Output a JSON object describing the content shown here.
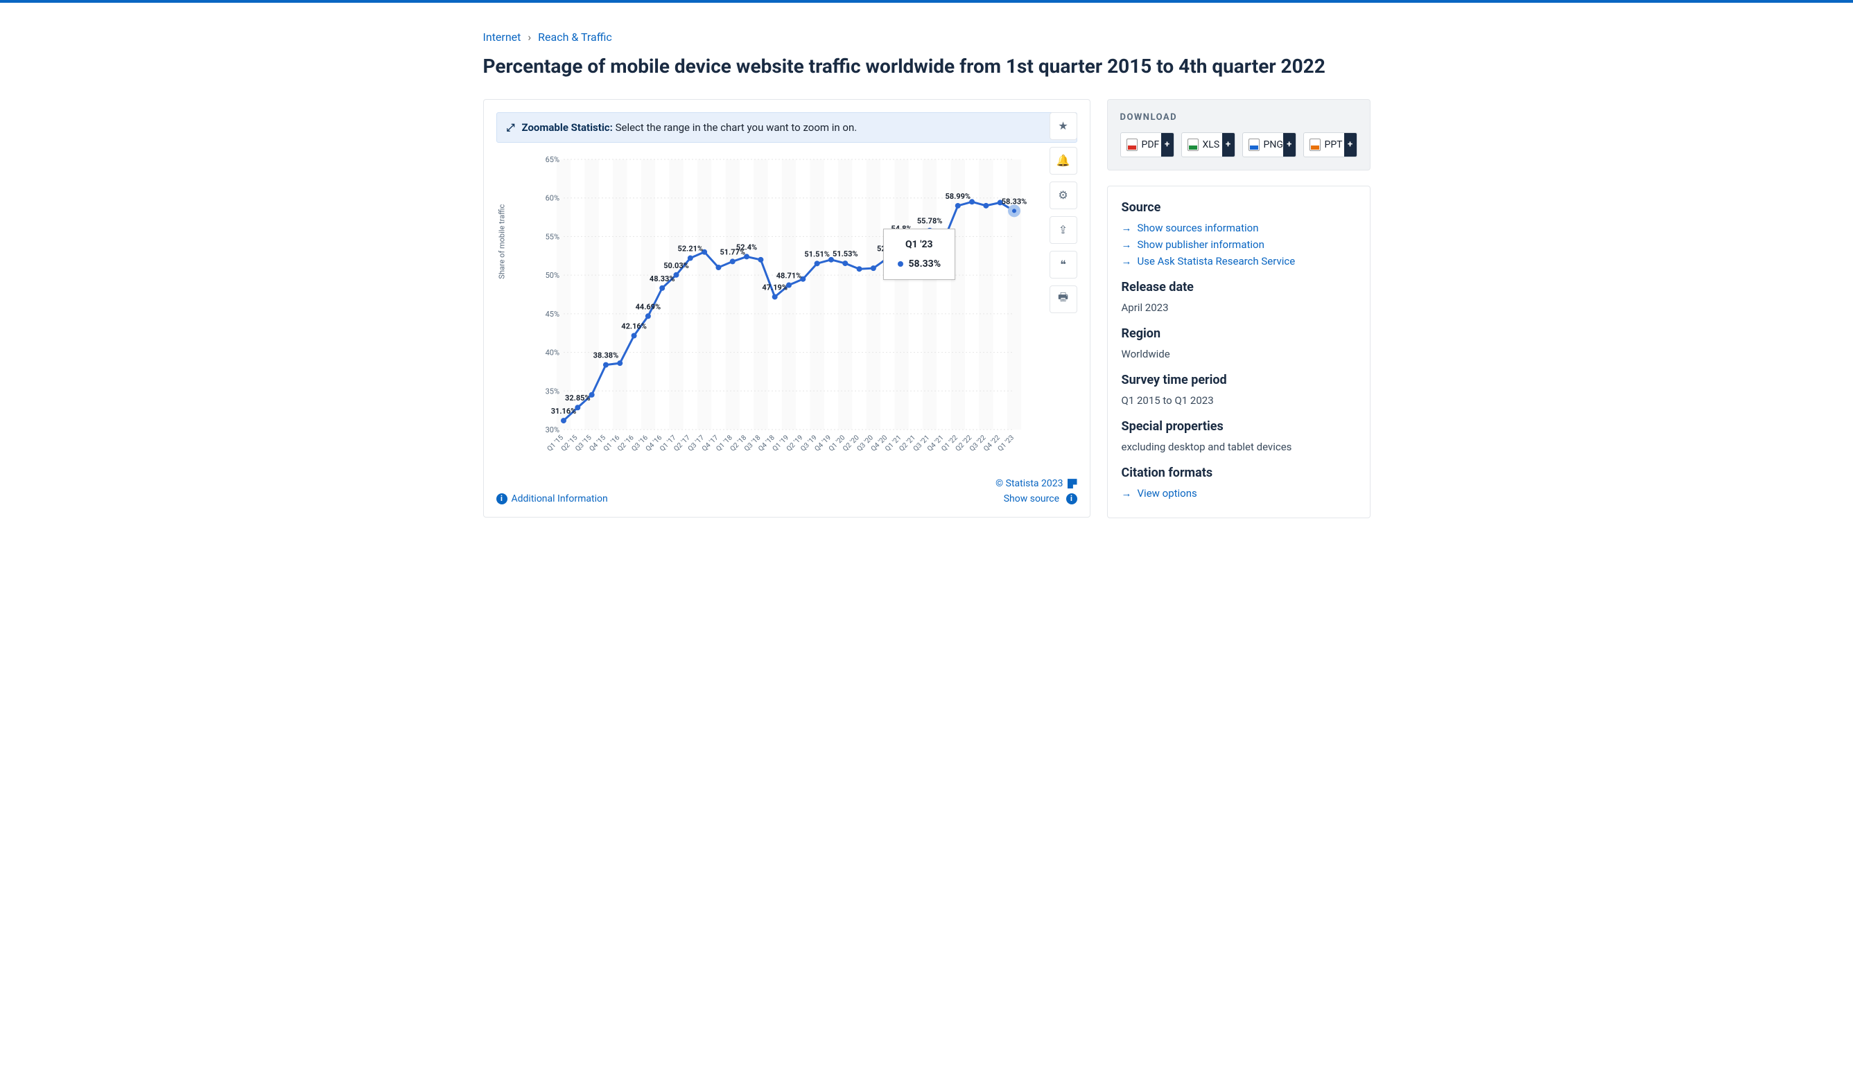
{
  "breadcrumbs": [
    "Internet",
    "Reach & Traffic"
  ],
  "title": "Percentage of mobile device website traffic worldwide from 1st quarter 2015 to 4th quarter 2022",
  "zoom_hint": {
    "label": "Zoomable Statistic:",
    "text": "Select the range in the chart you want to zoom in on."
  },
  "tooltip": {
    "quarter": "Q1 '23",
    "value": "58.33%"
  },
  "footer": {
    "additional": "Additional Information",
    "copyright": "© Statista 2023",
    "show_source": "Show source"
  },
  "download": {
    "heading": "DOWNLOAD",
    "buttons": [
      "PDF",
      "XLS",
      "PNG",
      "PPT"
    ]
  },
  "source": {
    "heading": "Source",
    "links": [
      "Show sources information",
      "Show publisher information",
      "Use Ask Statista Research Service"
    ]
  },
  "meta": [
    {
      "h": "Release date",
      "v": "April 2023"
    },
    {
      "h": "Region",
      "v": "Worldwide"
    },
    {
      "h": "Survey time period",
      "v": "Q1 2015 to Q1 2023"
    },
    {
      "h": "Special properties",
      "v": "excluding desktop and tablet devices"
    }
  ],
  "citation": {
    "h": "Citation formats",
    "link": "View options"
  },
  "chart_data": {
    "type": "line",
    "ylabel": "Share of mobile traffic",
    "ylim": [
      30,
      65
    ],
    "yticks": [
      30,
      35,
      40,
      45,
      50,
      55,
      60,
      65
    ],
    "categories": [
      "Q1 '15",
      "Q2 '15",
      "Q3 '15",
      "Q4 '15",
      "Q1 '16",
      "Q2 '16",
      "Q3 '16",
      "Q4 '16",
      "Q1 '17",
      "Q2 '17",
      "Q3 '17",
      "Q4 '17",
      "Q1 '18",
      "Q2 '18",
      "Q3 '18",
      "Q4 '18",
      "Q1 '19",
      "Q2 '19",
      "Q3 '19",
      "Q4 '19",
      "Q1 '20",
      "Q2 '20",
      "Q3 '20",
      "Q4 '20",
      "Q1 '21",
      "Q2 '21",
      "Q3 '21",
      "Q4 '21",
      "Q1 '22",
      "Q2 '22",
      "Q3 '22",
      "Q4 '22",
      "Q1 '23"
    ],
    "values": [
      31.16,
      32.85,
      34.5,
      38.38,
      38.6,
      42.16,
      44.69,
      48.33,
      50.03,
      52.21,
      53.0,
      51.0,
      51.77,
      52.4,
      52.0,
      47.19,
      48.71,
      49.5,
      51.51,
      52.0,
      51.53,
      50.8,
      50.9,
      52.2,
      54.8,
      55.0,
      55.78,
      54.5,
      58.99,
      59.5,
      59.0,
      59.4,
      58.33
    ],
    "labeled_points": {
      "Q1 '15": "31.16%",
      "Q2 '15": "32.85%",
      "Q4 '15": "38.38%",
      "Q2 '16": "42.16%",
      "Q3 '16": "44.69%",
      "Q4 '16": "48.33%",
      "Q1 '17": "50.03%",
      "Q2 '17": "52.21%",
      "Q1 '18": "51.77%",
      "Q2 '18": "52.4%",
      "Q4 '18": "47.19%",
      "Q1 '19": "48.71%",
      "Q3 '19": "51.51%",
      "Q1 '20": "51.53%",
      "Q4 '20": "52.2%",
      "Q1 '21": "54.8%",
      "Q3 '21": "55.78%",
      "Q1 '22": "58.99%",
      "Q1 '23": "58.33%"
    }
  }
}
